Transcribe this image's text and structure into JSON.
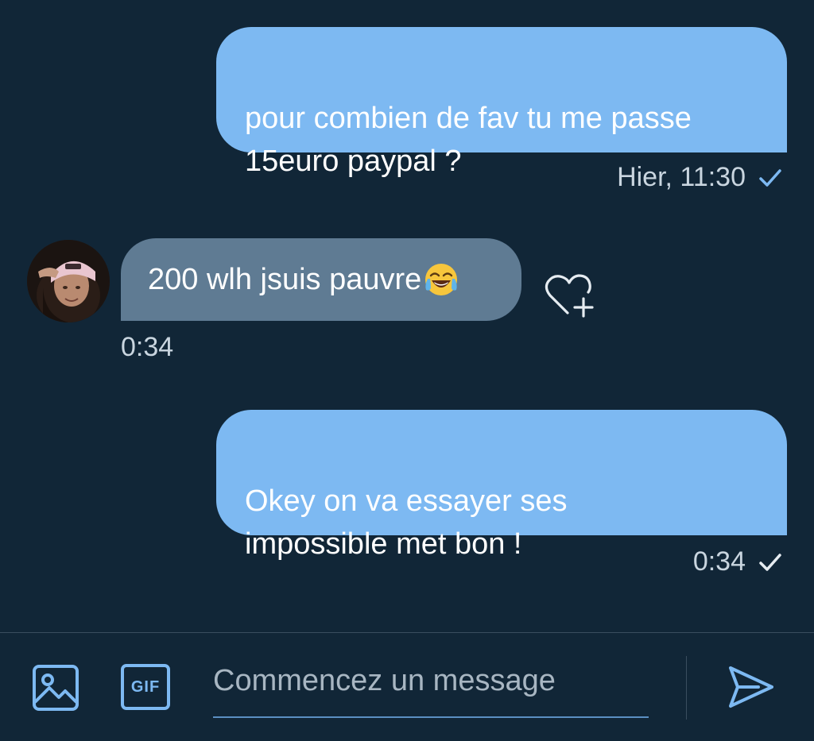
{
  "colors": {
    "background": "#112637",
    "outgoing_bubble": "#7db9f2",
    "incoming_bubble": "#5f7b93",
    "accent": "#7db9f2",
    "meta_text": "#c9d5df"
  },
  "messages": [
    {
      "direction": "outgoing",
      "text": "pour combien de fav tu me passe\n15euro paypal ?",
      "time": "Hier, 11:30",
      "status_icon": "check-icon",
      "status_color": "#7db9f2"
    },
    {
      "direction": "incoming",
      "text": "200 wlh jsuis pauvre",
      "emoji": "tears-of-joy-emoji",
      "time": "0:34",
      "reaction_icon": "heart-plus-icon"
    },
    {
      "direction": "outgoing",
      "text": "Okey on va essayer ses\nimpossible met bon !",
      "time": "0:34",
      "status_icon": "check-icon",
      "status_color": "#e6ecf1"
    }
  ],
  "composer": {
    "media_icon": "image-icon",
    "gif_label": "GIF",
    "placeholder": "Commencez un message",
    "send_icon": "send-icon"
  }
}
